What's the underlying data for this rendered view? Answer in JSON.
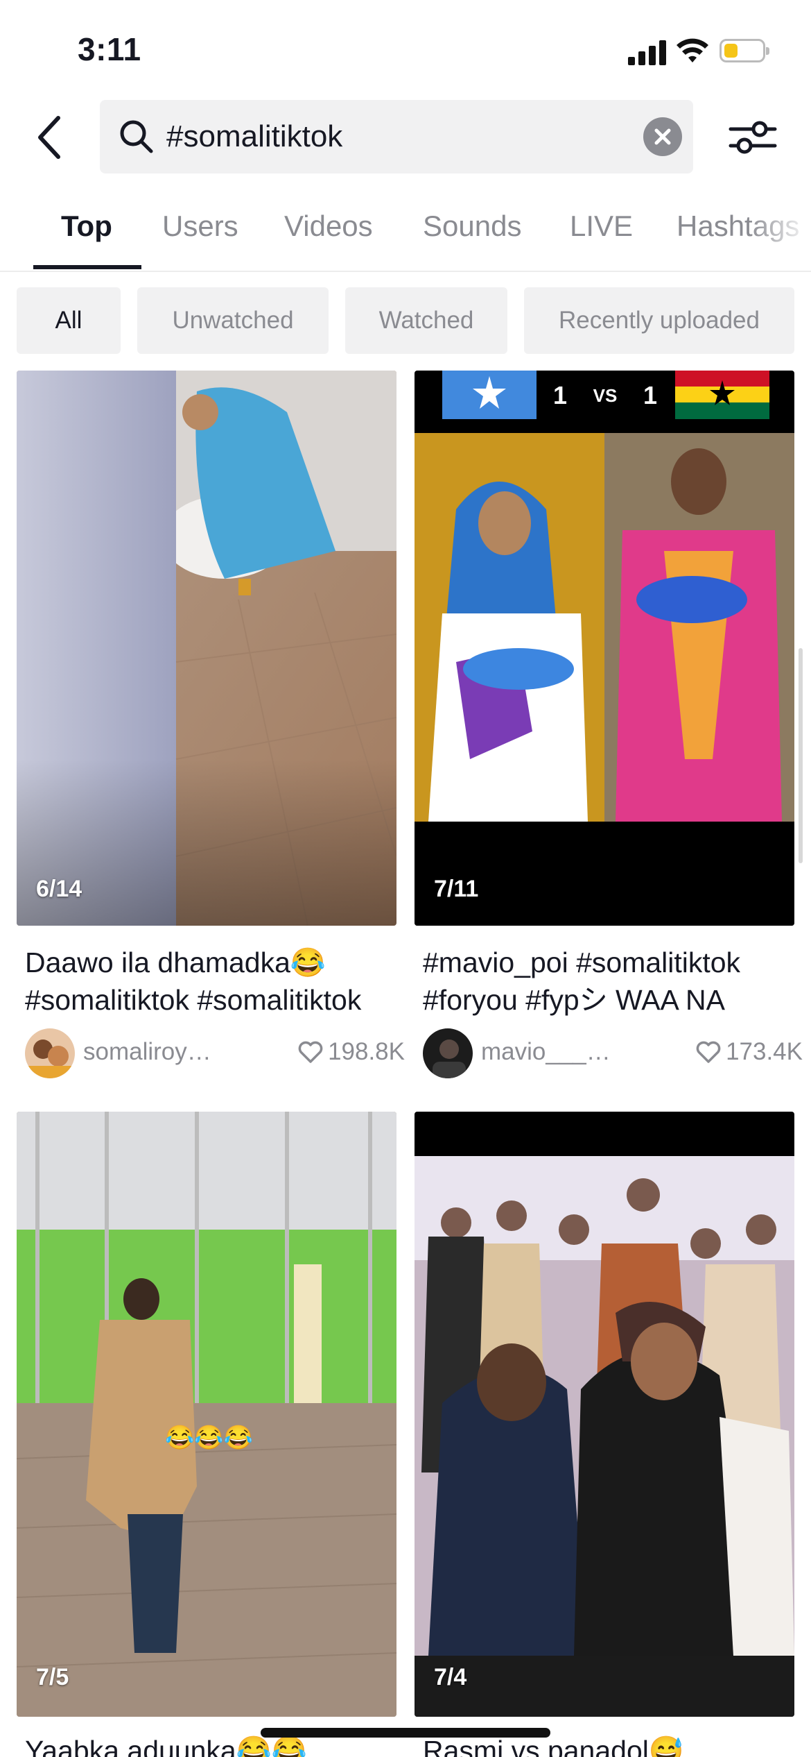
{
  "status_bar": {
    "time": "3:11",
    "battery_level": 0.35,
    "battery_color": "#f5c518"
  },
  "search": {
    "query": "#somalitiktok"
  },
  "tabs": [
    {
      "label": "Top"
    },
    {
      "label": "Users"
    },
    {
      "label": "Videos"
    },
    {
      "label": "Sounds"
    },
    {
      "label": "LIVE"
    },
    {
      "label": "Hashtags"
    }
  ],
  "active_tab": "Top",
  "filters": [
    {
      "label": "All"
    },
    {
      "label": "Unwatched"
    },
    {
      "label": "Watched"
    },
    {
      "label": "Recently uploaded"
    }
  ],
  "active_filter": "All",
  "videos": [
    {
      "date": "6/14",
      "caption_line1": "Daawo ila dhamadka😂",
      "caption_line2": "#somalitiktok #somalitiktok",
      "username": "somaliroyalfamily",
      "likes": "198.8K"
    },
    {
      "date": "7/11",
      "caption_line1": "#mavio_poi #somalitiktok",
      "caption_line2": "#foryou #fypシ WAA NA",
      "username": "mavio_____poi",
      "likes": "173.4K",
      "overlay": {
        "score_left": "1",
        "vs": "VS",
        "score_right": "1"
      }
    },
    {
      "date": "7/5",
      "caption_line1": "Yaabka aduunka😂😂",
      "overlay_emoji": "😂😂😂"
    },
    {
      "date": "7/4",
      "caption_line1": "Rasmi vs panadol😅"
    }
  ],
  "colors": {
    "text": "#161823",
    "muted": "#8a8b91",
    "chip_bg": "#f1f1f2"
  }
}
